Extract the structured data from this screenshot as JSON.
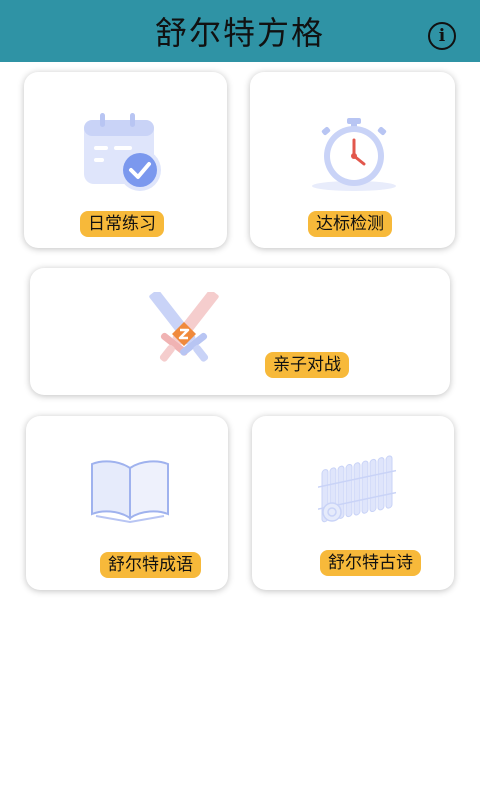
{
  "header": {
    "title": "舒尔特方格",
    "info_icon": "info-icon"
  },
  "cards": [
    {
      "label": "日常练习",
      "icon": "calendar-check-icon"
    },
    {
      "label": "达标检测",
      "icon": "stopwatch-icon"
    },
    {
      "label": "亲子对战",
      "icon": "crossed-swords-icon"
    },
    {
      "label": "舒尔特成语",
      "icon": "open-book-icon"
    },
    {
      "label": "舒尔特古诗",
      "icon": "bamboo-scroll-icon"
    }
  ],
  "colors": {
    "header_bg": "#2f93a5",
    "badge_bg": "#f7b93a"
  }
}
